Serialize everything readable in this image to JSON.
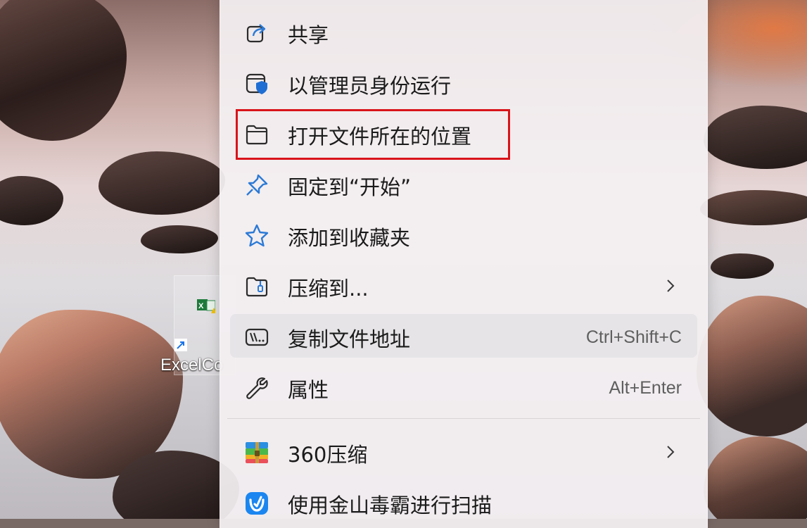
{
  "desktop": {
    "icon_label": "ExcelCo"
  },
  "context_menu": {
    "items": [
      {
        "label": "共享",
        "icon": "share-icon"
      },
      {
        "label": "以管理员身份运行",
        "icon": "shield-icon"
      },
      {
        "label": "打开文件所在的位置",
        "icon": "folder-icon"
      },
      {
        "label": "固定到“开始”",
        "icon": "pin-icon"
      },
      {
        "label": "添加到收藏夹",
        "icon": "star-icon"
      },
      {
        "label": "压缩到...",
        "icon": "zip-folder-icon",
        "submenu": true
      },
      {
        "label": "复制文件地址",
        "icon": "copy-path-icon",
        "shortcut": "Ctrl+Shift+C"
      },
      {
        "label": "属性",
        "icon": "wrench-icon",
        "shortcut": "Alt+Enter"
      },
      {
        "label": "360压缩",
        "icon": "360-zip-icon",
        "submenu": true
      },
      {
        "label": "使用金山毒霸进行扫描",
        "icon": "duba-icon"
      }
    ]
  },
  "colors": {
    "highlight_border": "#d9141b",
    "accent_blue": "#0067c0",
    "menu_background": "#f3eff1"
  }
}
